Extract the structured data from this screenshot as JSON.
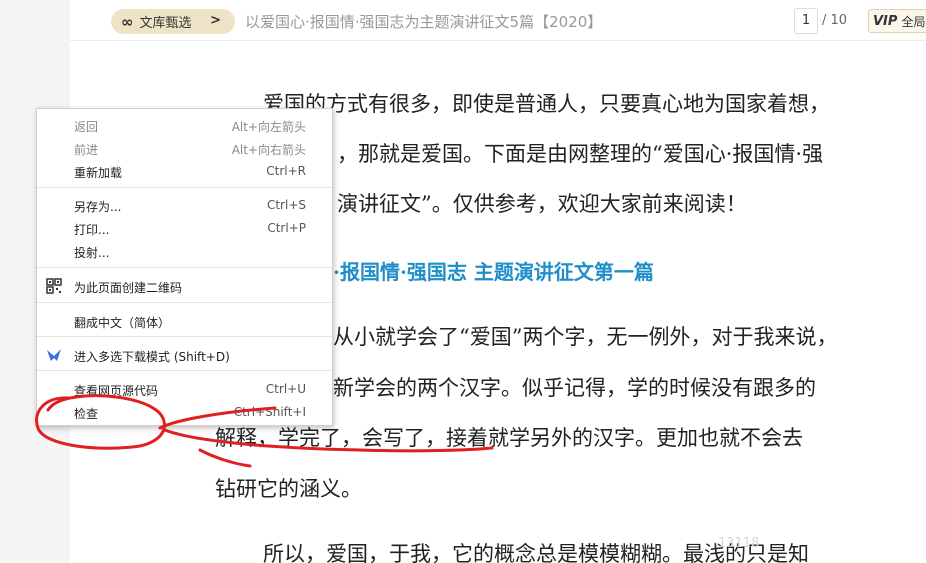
{
  "toolbar": {
    "brand_logo": "∞",
    "brand_label": "文库甄选",
    "brand_chevron": ">",
    "doc_title": "以爱国心·报国情·强国志为主题演讲征文5篇【2020】",
    "page_current": "1",
    "page_total": "/ 10",
    "vip_badge": "VIP",
    "vip_label": "全局"
  },
  "document": {
    "paragraph1": [
      "爱国的方式有很多，即使是普通人，只要真心地为国家着想，",
      "，那就是爱国。下面是由网整理的“爱国心·报国情·强",
      "演讲征文”。仅供参考，欢迎大家前来阅读！"
    ],
    "heading": "·报国情·强国志  主题演讲征文第一篇",
    "paragraph2": [
      "从小就学会了“爱国”两个字，无一例外，对于我来说，",
      "新学会的两个汉字。似乎记得，学的时候没有跟多的",
      "解释，学完了，会写了，接着就学另外的汉字。更加也就不会去",
      "钻研它的涵义。"
    ],
    "paragraph3": "所以，爱国，于我，它的概念总是模模糊糊。最浅的只是知",
    "watermark": "13118"
  },
  "context_menu": {
    "items": [
      {
        "label": "返回",
        "shortcut": "Alt+向左箭头",
        "disabled": true
      },
      {
        "label": "前进",
        "shortcut": "Alt+向右箭头",
        "disabled": true
      },
      {
        "label": "重新加载",
        "shortcut": "Ctrl+R",
        "disabled": false
      },
      {
        "label": "另存为...",
        "shortcut": "Ctrl+S",
        "disabled": false
      },
      {
        "label": "打印...",
        "shortcut": "Ctrl+P",
        "disabled": false
      },
      {
        "label": "投射...",
        "shortcut": "",
        "disabled": false
      },
      {
        "label": "为此页面创建二维码",
        "shortcut": "",
        "icon": "qr-code-icon",
        "disabled": false
      },
      {
        "label": "翻成中文（简体）",
        "shortcut": "",
        "disabled": false
      },
      {
        "label": "进入多选下载模式 (Shift+D)",
        "shortcut": "",
        "icon": "download-arrow-icon",
        "disabled": false
      },
      {
        "label": "查看网页源代码",
        "shortcut": "Ctrl+U",
        "disabled": false
      },
      {
        "label": "检查",
        "shortcut": "Ctrl+Shift+I",
        "disabled": false
      }
    ]
  },
  "colors": {
    "heading_blue": "#1f8ec9",
    "brand_pill": "#efe3c7",
    "annotation_red": "#e02020",
    "download_icon_blue": "#3b6df0"
  }
}
